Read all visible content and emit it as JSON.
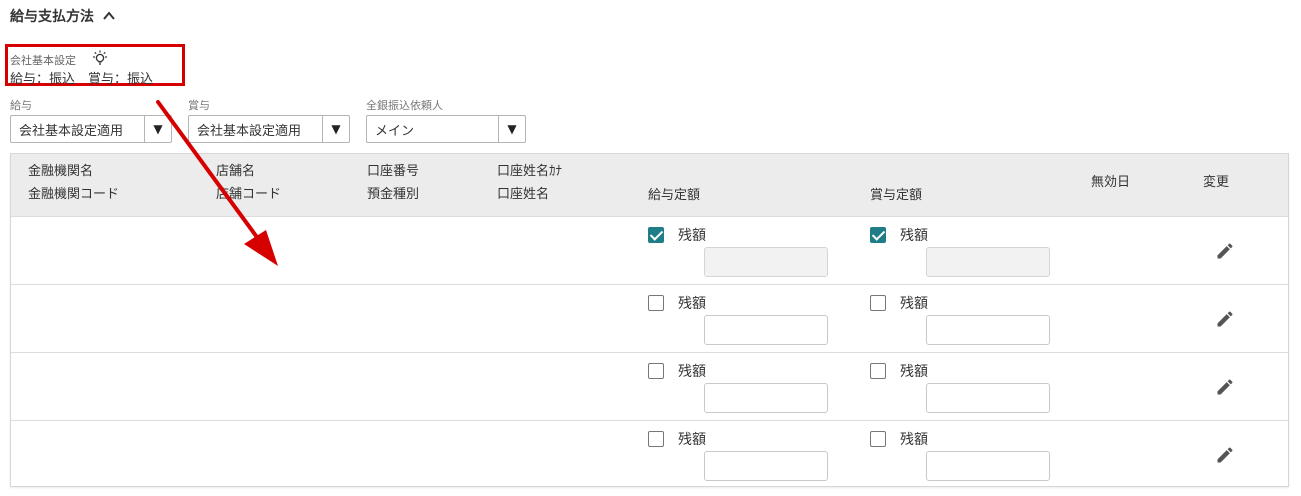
{
  "section": {
    "title": "給与支払方法"
  },
  "company_default": {
    "label": "会社基本設定",
    "values": "給与：振込　賞与：振込"
  },
  "fields": {
    "salary": {
      "label": "給与",
      "value": "会社基本設定適用"
    },
    "bonus": {
      "label": "賞与",
      "value": "会社基本設定適用"
    },
    "requester": {
      "label": "全銀振込依頼人",
      "value": "メイン"
    }
  },
  "table": {
    "headers": {
      "bank_name": "金融機関名",
      "bank_code": "金融機関コード",
      "branch_name": "店舗名",
      "branch_code": "店舗コード",
      "account_number": "口座番号",
      "deposit_type": "預金種別",
      "account_holder_kana": "口座姓名ｶﾅ",
      "account_holder": "口座姓名",
      "salary_fixed": "給与定額",
      "bonus_fixed": "賞与定額",
      "invalid_date": "無効日",
      "change": "変更"
    },
    "rows": [
      {
        "salary_remainder_label": "残額",
        "salary_remainder_checked": true,
        "bonus_remainder_label": "残額",
        "bonus_remainder_checked": true
      },
      {
        "salary_remainder_label": "残額",
        "salary_remainder_checked": false,
        "bonus_remainder_label": "残額",
        "bonus_remainder_checked": false
      },
      {
        "salary_remainder_label": "残額",
        "salary_remainder_checked": false,
        "bonus_remainder_label": "残額",
        "bonus_remainder_checked": false
      },
      {
        "salary_remainder_label": "残額",
        "salary_remainder_checked": false,
        "bonus_remainder_label": "残額",
        "bonus_remainder_checked": false
      }
    ]
  },
  "colors": {
    "highlight": "#d70000",
    "checkbox": "#1f7d88"
  },
  "icons": {
    "collapse": "chevron-up-icon",
    "hint": "lightbulb-icon",
    "dropdown": "triangle-down-icon",
    "edit": "pencil-icon"
  }
}
